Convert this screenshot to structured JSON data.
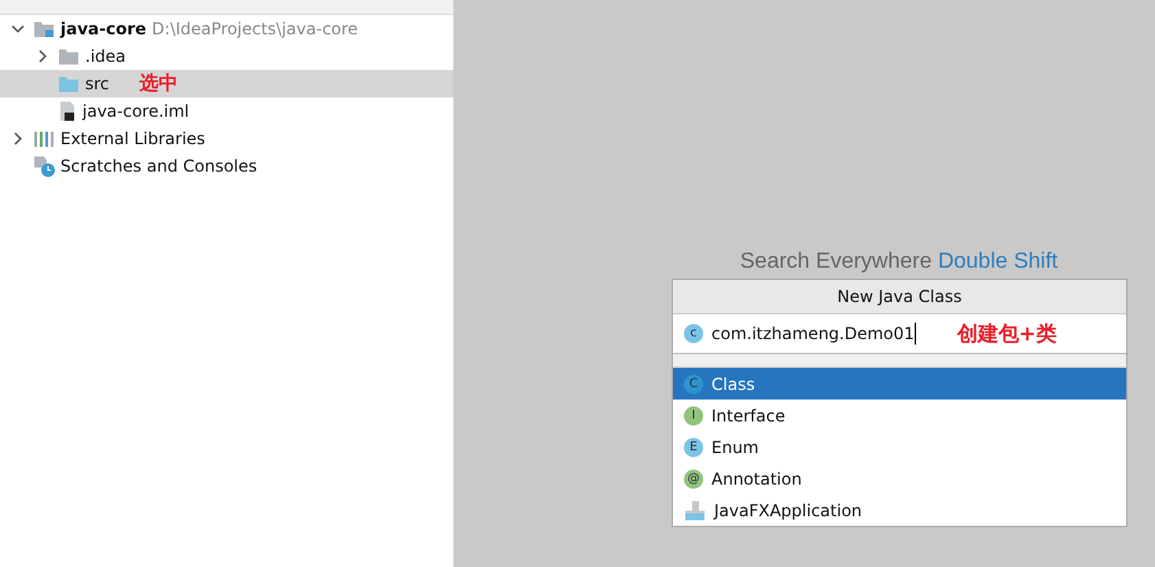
{
  "project_tree": [
    {
      "name": "java-core",
      "path": "D:\\IdeaProjects\\java-core",
      "kind": "module",
      "expanded": true,
      "selected": false,
      "children": [
        {
          "name": ".idea",
          "kind": "folder",
          "expanded": false,
          "selected": false
        },
        {
          "name": "src",
          "kind": "source",
          "selected": true,
          "note": "选中"
        },
        {
          "name": "java-core.iml",
          "kind": "file",
          "selected": false
        }
      ]
    },
    {
      "name": "External Libraries",
      "kind": "libraries",
      "expanded": false,
      "selected": false
    },
    {
      "name": "Scratches and Consoles",
      "kind": "scratches",
      "selected": false
    }
  ],
  "hint": {
    "text": "Search Everywhere",
    "shortcut": "Double Shift"
  },
  "dialog": {
    "title": "New Java Class",
    "value": "com.itzhameng.Demo01",
    "value_icon": "c",
    "note": "创建包+类",
    "options": [
      {
        "label": "Class",
        "letter": "C",
        "kind": "class",
        "selected": true
      },
      {
        "label": "Interface",
        "letter": "I",
        "kind": "interface",
        "selected": false
      },
      {
        "label": "Enum",
        "letter": "E",
        "kind": "enum",
        "selected": false
      },
      {
        "label": "Annotation",
        "letter": "@",
        "kind": "annotation",
        "selected": false
      },
      {
        "label": "JavaFXApplication",
        "kind": "javafx",
        "selected": false
      }
    ]
  }
}
